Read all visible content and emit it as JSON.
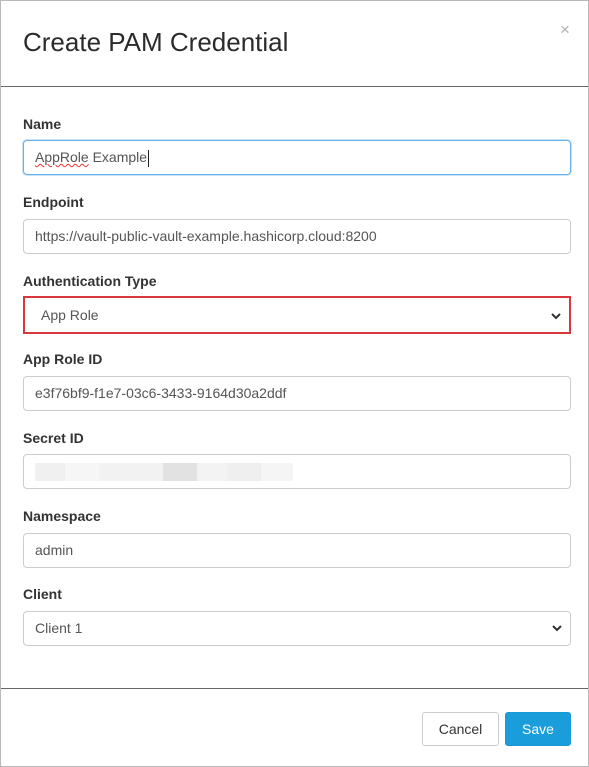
{
  "modal": {
    "title": "Create PAM Credential",
    "close_glyph": "×"
  },
  "fields": {
    "name": {
      "label": "Name",
      "value_word1": "AppRole",
      "value_rest": " Example"
    },
    "endpoint": {
      "label": "Endpoint",
      "value": "https://vault-public-vault-example.hashicorp.cloud:8200"
    },
    "auth_type": {
      "label": "Authentication Type",
      "value": "App Role"
    },
    "app_role_id": {
      "label": "App Role ID",
      "value": "e3f76bf9-f1e7-03c6-3433-9164d30a2ddf"
    },
    "secret_id": {
      "label": "Secret ID"
    },
    "namespace": {
      "label": "Namespace",
      "value": "admin"
    },
    "client": {
      "label": "Client",
      "value": "Client 1"
    }
  },
  "footer": {
    "cancel_label": "Cancel",
    "save_label": "Save"
  },
  "colors": {
    "primary": "#1a9ddb",
    "highlight_border": "#d9363e",
    "focus_border": "#66afe9"
  },
  "icons": {
    "close": "close-icon",
    "select_arrow": "chevron-down-icon"
  }
}
